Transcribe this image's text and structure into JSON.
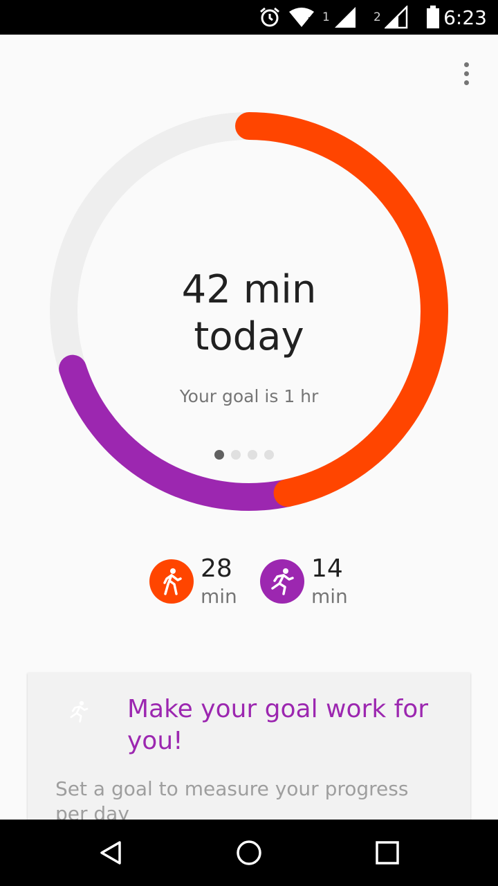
{
  "status_bar": {
    "time": "6:23",
    "sim1": "1",
    "sim2": "2",
    "icons": [
      "alarm-icon",
      "wifi-icon",
      "signal-icon",
      "battery-icon"
    ]
  },
  "ring": {
    "value_text": "42 min",
    "period_text": "today",
    "goal_text": "Your goal is 1 hr",
    "goal_minutes": 60,
    "segments": [
      {
        "activity": "walking",
        "minutes": 28,
        "color": "#ff4500"
      },
      {
        "activity": "running",
        "minutes": 14,
        "color": "#9c27b0"
      }
    ],
    "track_color": "#eeeeee",
    "page_count": 4,
    "active_page": 0
  },
  "activities": [
    {
      "icon": "walking-icon",
      "value": "28",
      "unit": "min",
      "color": "#ff4500"
    },
    {
      "icon": "running-icon",
      "value": "14",
      "unit": "min",
      "color": "#9c27b0"
    }
  ],
  "card": {
    "icon": "running-icon",
    "title": "Make your goal work for you!",
    "description": "Set a goal to measure your progress per day"
  },
  "nav_bar": {
    "icons": [
      "back-icon",
      "home-icon",
      "recents-icon"
    ]
  },
  "colors": {
    "accent_orange": "#ff4500",
    "accent_purple": "#9c27b0"
  }
}
